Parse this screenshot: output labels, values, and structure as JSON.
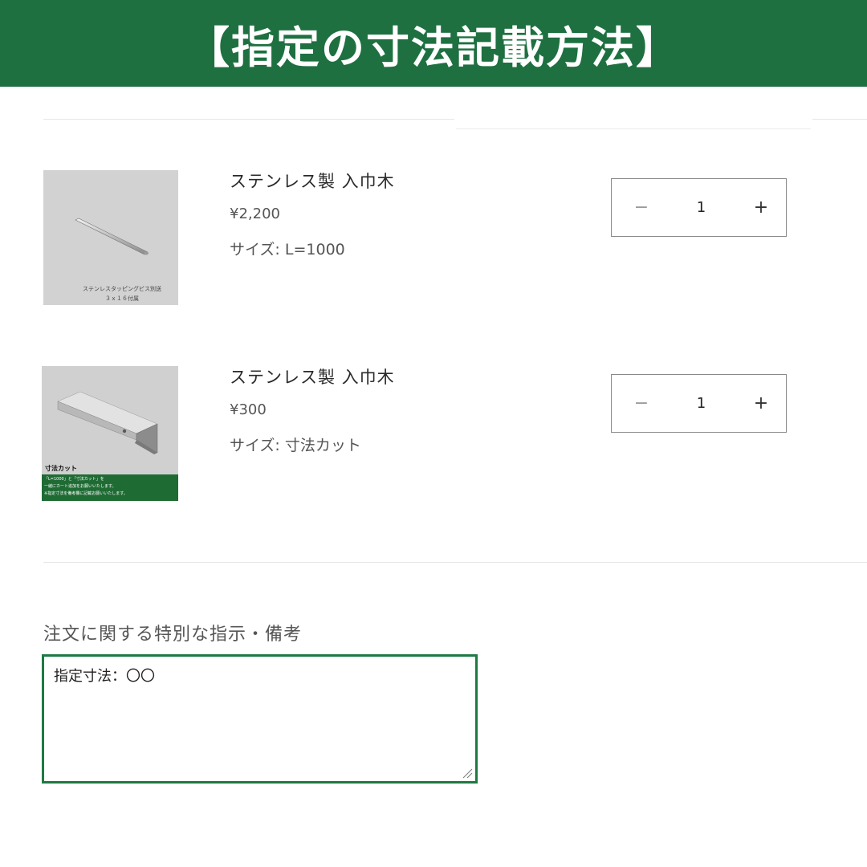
{
  "banner": {
    "title": "【指定の寸法記載方法】"
  },
  "cart": {
    "items": [
      {
        "name": "ステンレス製 入巾木",
        "price": "¥2,200",
        "size_label": "サイズ:",
        "size_value": "L=1000",
        "quantity": "1",
        "image": {
          "caption_lines": [
            "ステンレスタッピングビス別送",
            "３ｘ１６付属"
          ]
        }
      },
      {
        "name": "ステンレス製 入巾木",
        "price": "¥300",
        "size_label": "サイズ:",
        "size_value": "寸法カット",
        "quantity": "1",
        "image": {
          "label": "寸法カット",
          "note_lines": [
            "「L=1000」と「寸法カット」を",
            "一緒にカート追加をお願いいたします。",
            "※指定寸法を備考欄に記載お願いいたします。"
          ]
        }
      }
    ],
    "quantity_controls": {
      "minus": "−",
      "plus": "+"
    }
  },
  "notes": {
    "label": "注文に関する特別な指示・備考",
    "value": "指定寸法：〇〇"
  },
  "colors": {
    "brand_green": "#1e7040",
    "textarea_border": "#1e7a42"
  }
}
